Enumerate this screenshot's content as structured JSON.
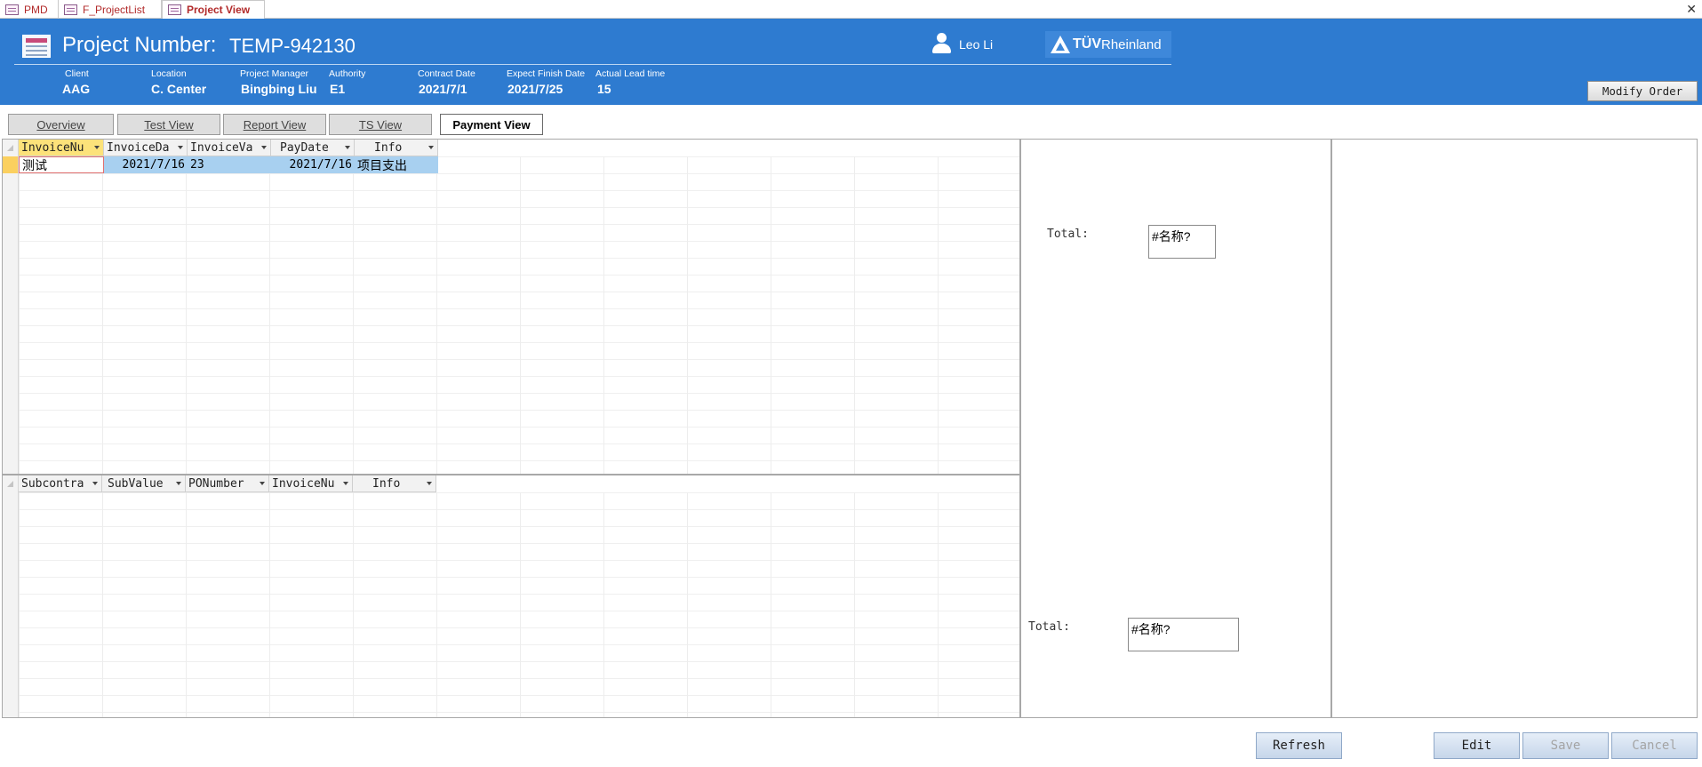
{
  "tabs": [
    {
      "label": "PMD"
    },
    {
      "label": "F_ProjectList"
    },
    {
      "label": "Project View",
      "active": true
    }
  ],
  "header": {
    "project_number_label": "Project Number:",
    "project_number": "TEMP-942130",
    "user_name": "Leo Li",
    "logo_text_1": "TÜV",
    "logo_text_2": "Rheinland",
    "modify_order": "Modify Order",
    "fields": {
      "client": {
        "label": "Client",
        "value": "AAG"
      },
      "location": {
        "label": "Location",
        "value": "C. Center"
      },
      "manager": {
        "label": "Project Manager",
        "value": "Bingbing Liu"
      },
      "authority": {
        "label": "Authority",
        "value": "E1"
      },
      "contract_date": {
        "label": "Contract Date",
        "value": "2021/7/1"
      },
      "finish_date": {
        "label": "Expect Finish Date",
        "value": "2021/7/25"
      },
      "lead_time": {
        "label": "Actual Lead time",
        "value": "15"
      }
    }
  },
  "views": {
    "overview": "Overview",
    "test": "Test View",
    "report": "Report View",
    "ts": "TS View",
    "payment": "Payment View"
  },
  "invoice_table": {
    "columns": [
      "InvoiceNu",
      "InvoiceDa",
      "InvoiceVa",
      "PayDate",
      "Info"
    ],
    "rows": [
      [
        "测试",
        "2021/7/16",
        "23",
        "2021/7/16",
        "项目支出"
      ]
    ]
  },
  "sub_table": {
    "columns": [
      "Subcontra",
      "SubValue",
      "PONumber",
      "InvoiceNu",
      "Info"
    ]
  },
  "totals": {
    "top_label": "Total:",
    "top_value": "#名称?",
    "bottom_label": "Total:",
    "bottom_value": "#名称?"
  },
  "buttons": {
    "refresh": "Refresh",
    "edit": "Edit",
    "save": "Save",
    "cancel": "Cancel"
  },
  "colors": {
    "header_bg": "#2e7bd0",
    "accent_red": "#b22a2a",
    "selection_blue": "#a8d0f0",
    "header_highlight": "#fce27a"
  }
}
